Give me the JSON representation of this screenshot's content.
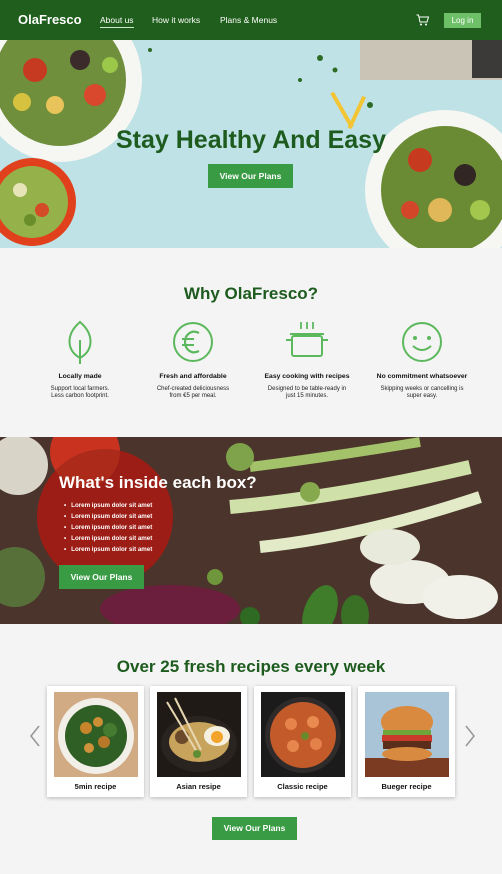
{
  "nav": {
    "brand": "OlaFresco",
    "links": [
      "About us",
      "How it works",
      "Plans & Menus"
    ],
    "login": "Log in",
    "cart_icon": "cart-icon"
  },
  "hero": {
    "title": "Stay Healthy And Easy",
    "button": "View Our Plans"
  },
  "why": {
    "title": "Why OlaFresco?",
    "features": [
      {
        "icon": "leaf-icon",
        "title": "Locally made",
        "desc1": "Support local farmers.",
        "desc2": "Less carbon footprint."
      },
      {
        "icon": "euro-icon",
        "title": "Fresh and affordable",
        "desc1": "Chef-created deliciousness",
        "desc2": "from €5 per meal."
      },
      {
        "icon": "pot-icon",
        "title": "Easy cooking with recipes",
        "desc1": "Designed to be table-ready in",
        "desc2": "just 15 minutes."
      },
      {
        "icon": "smiley-icon",
        "title": "No commitment whatsoever",
        "desc1": "Skipping weeks or cancelling is",
        "desc2": "super easy."
      }
    ]
  },
  "box": {
    "title": "What's inside each box?",
    "items": [
      "Lorem ipsum dolor sit amet",
      "Lorem ipsum dolor sit amet",
      "Lorem ipsum dolor sit amet",
      "Lorem ipsum dolor sit amet",
      "Lorem ipsum dolor sit amet"
    ],
    "button": "View Our Plans"
  },
  "recipes": {
    "title": "Over 25 fresh recipes every week",
    "cards": [
      "5min recipe",
      "Asian resipe",
      "Classic recipe",
      "Bueger recipe"
    ],
    "button": "View Our Plans"
  },
  "colors": {
    "brand_green": "#1f5e1c",
    "button_green": "#3a9b45",
    "login_green": "#6dc067",
    "icon_green": "#5cb85c"
  }
}
